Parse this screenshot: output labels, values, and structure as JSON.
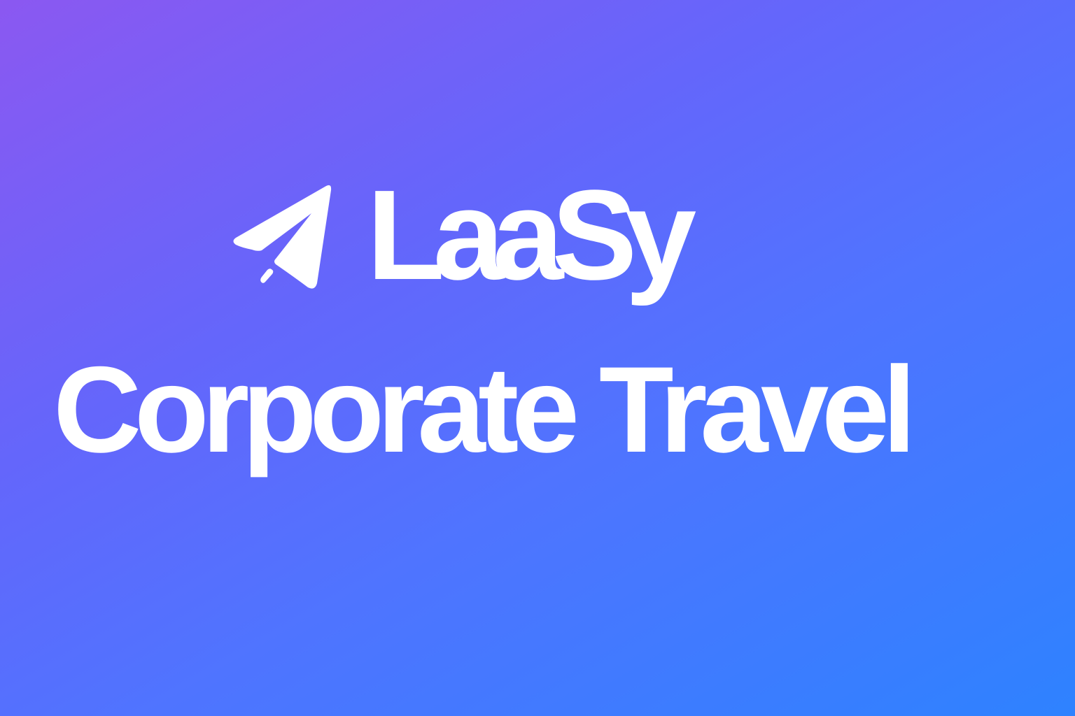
{
  "brand": {
    "name": "LaaSy",
    "icon": "paper-plane-icon"
  },
  "tagline": "Corporate Travel",
  "colors": {
    "gradient_start": "#8b58f1",
    "gradient_end": "#2e82ff",
    "text": "#ffffff"
  }
}
